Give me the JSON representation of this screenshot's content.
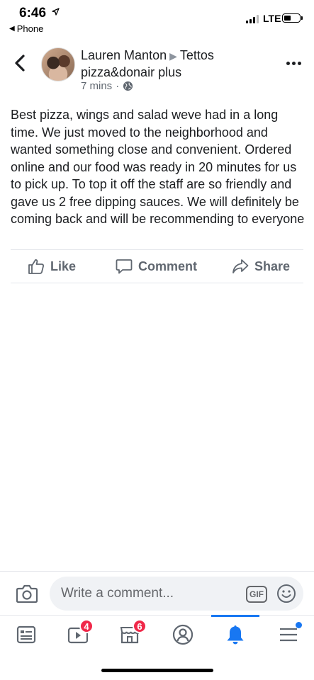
{
  "status_bar": {
    "time": "6:46",
    "back_app": "Phone",
    "network": "LTE"
  },
  "post": {
    "author": "Lauren Manton",
    "page": "Tettos pizza&donair plus",
    "time_ago": "7 mins",
    "privacy_icon": "globe-icon",
    "body": "Best pizza, wings and salad weve had in a long time. We just moved to the neighborhood and wanted something close and convenient. Ordered online and our food was ready in 20 minutes for us to pick up. To top it off the staff are so friendly and gave us 2 free dipping sauces. We will definitely be coming back and will be recommending to everyone"
  },
  "actions": {
    "like": "Like",
    "comment": "Comment",
    "share": "Share"
  },
  "comment_bar": {
    "placeholder": "Write a comment...",
    "gif_label": "GIF"
  },
  "tab_bar": {
    "items": [
      {
        "name": "news-feed",
        "icon": "news-feed-icon"
      },
      {
        "name": "watch",
        "icon": "video-icon",
        "badge": "4"
      },
      {
        "name": "marketplace",
        "icon": "shop-icon",
        "badge": "6"
      },
      {
        "name": "profile",
        "icon": "profile-icon"
      },
      {
        "name": "notifications",
        "icon": "bell-icon",
        "active": true
      },
      {
        "name": "menu",
        "icon": "menu-icon"
      }
    ]
  },
  "colors": {
    "accent": "#1877f2",
    "badge": "#f02849",
    "text": "#1c1e21",
    "muted": "#606770"
  }
}
